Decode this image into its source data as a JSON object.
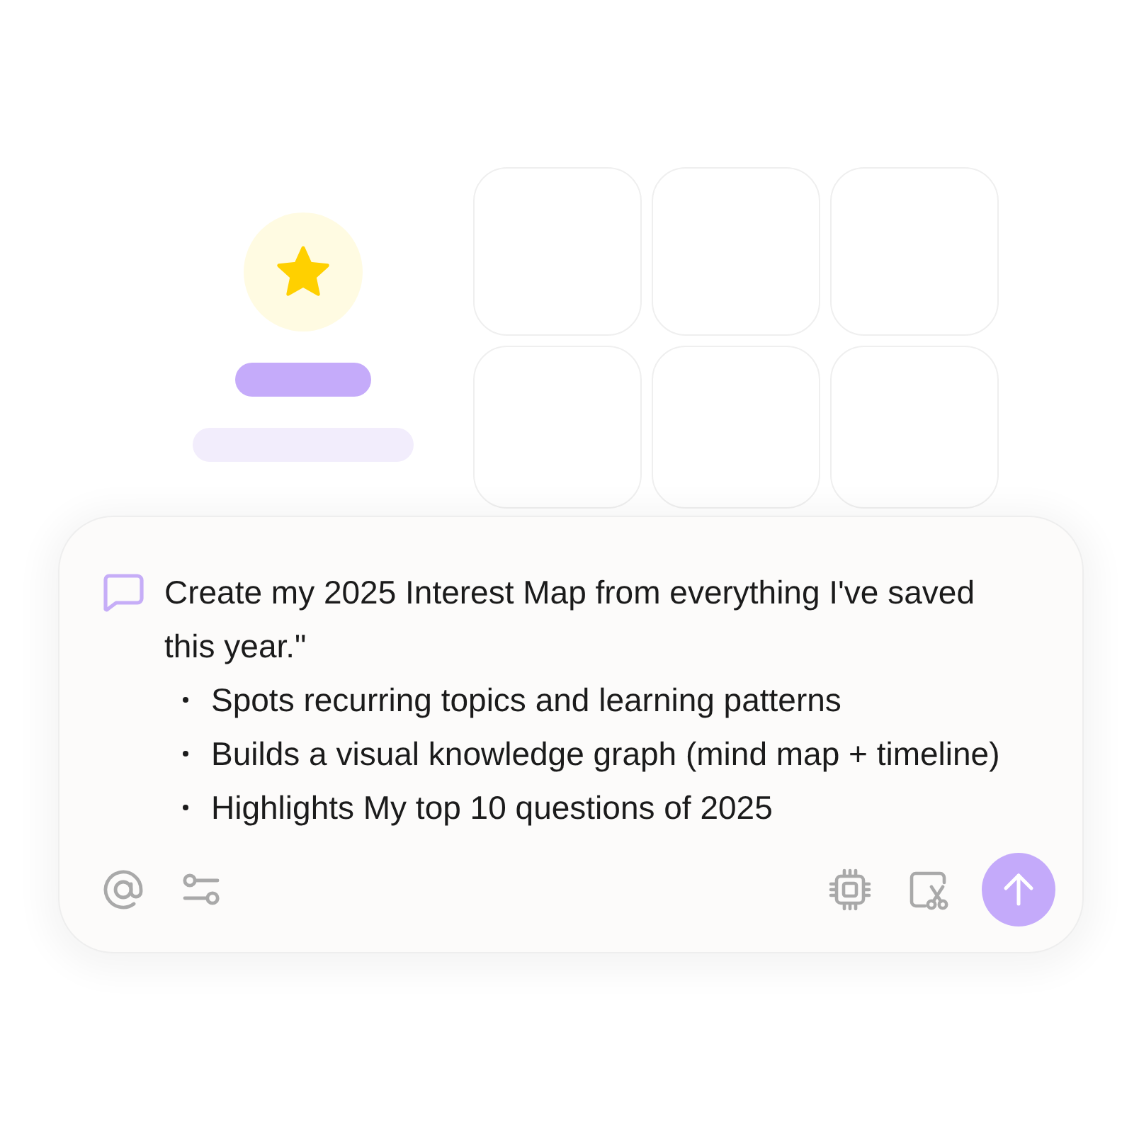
{
  "prompt_card": {
    "message": "Create my 2025 Interest Map from everything I've saved this year.\"",
    "bullets": [
      "Spots recurring topics and learning patterns",
      "Builds a visual knowledge graph (mind map + timeline)",
      "Highlights My top 10 questions of 2025"
    ]
  }
}
